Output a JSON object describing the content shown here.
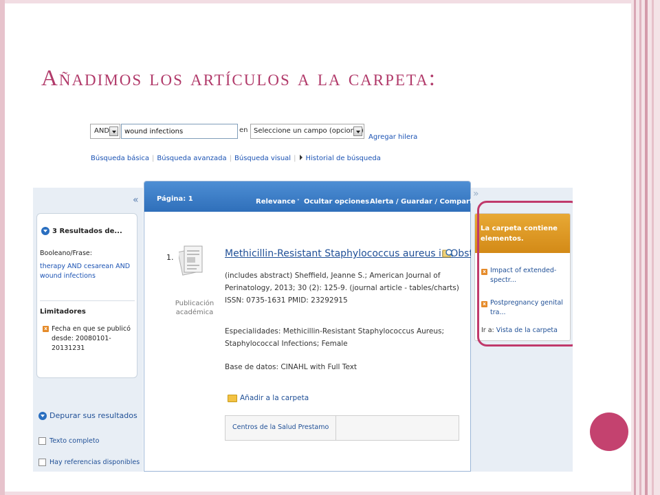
{
  "slide": {
    "title": "Añadimos los artículos a la carpeta:"
  },
  "search": {
    "bool_operator": "AND",
    "term": "wound infections",
    "field_prefix": "en",
    "field_value": "Seleccione un campo (opcional)",
    "add_row": "Agregar hilera"
  },
  "nav_links": {
    "basic": "Búsqueda básica",
    "advanced": "Búsqueda avanzada",
    "visual": "Búsqueda visual",
    "history": "Historial de búsqueda"
  },
  "left_pane": {
    "collapse_icon": "«",
    "results_heading": "3 Resultados de...",
    "bool_label": "Booleano/Frase:",
    "bool_value": "therapy AND cesarean AND wound infections",
    "limiters_heading": "Limitadores",
    "limiter_text": "Fecha en que se publicó desde: 20080101-20131231",
    "refine_heading": "Depurar sus resultados",
    "checkboxes": [
      "Texto completo",
      "Hay referencias disponibles"
    ]
  },
  "results": {
    "page_label": "Página: 1",
    "menu": [
      "Relevance",
      "Ocultar opciones",
      "Alerta / Guardar / Compartir"
    ],
    "items": [
      {
        "number": "1.",
        "pub_type": "Publicación académica",
        "title": "Methicillin-Resistant Staphylococcus aureus in Obstetrics.",
        "meta": "(includes abstract) Sheffield, Jeanne S.; American Journal of Perinatology, 2013; 30 (2): 125-9. (journal article - tables/charts) ISSN: 0735-1631 PMID: 23292915",
        "specialties": "Especialidades: Methicillin-Resistant Staphylococcus Aureus; Staphylococcal Infections; Female",
        "database": "Base de datos: CINAHL with Full Text",
        "add_to_folder": "Añadir a la carpeta",
        "holdings": "Centros de la Salud Prestamo"
      }
    ]
  },
  "folder": {
    "expand_icon": "»",
    "heading": "La carpeta contiene elementos.",
    "items": [
      "Impact of extended-spectr...",
      "Postpregnancy genital tra..."
    ],
    "goto_label": "Ir a:",
    "goto_link": "Vista de la carpeta"
  },
  "colors": {
    "title": "#b13a6a",
    "highlight": "#c0396b",
    "header_blue": "#3f7fc9",
    "folder_orange": "#dd9a27",
    "link": "#1f4f96"
  }
}
